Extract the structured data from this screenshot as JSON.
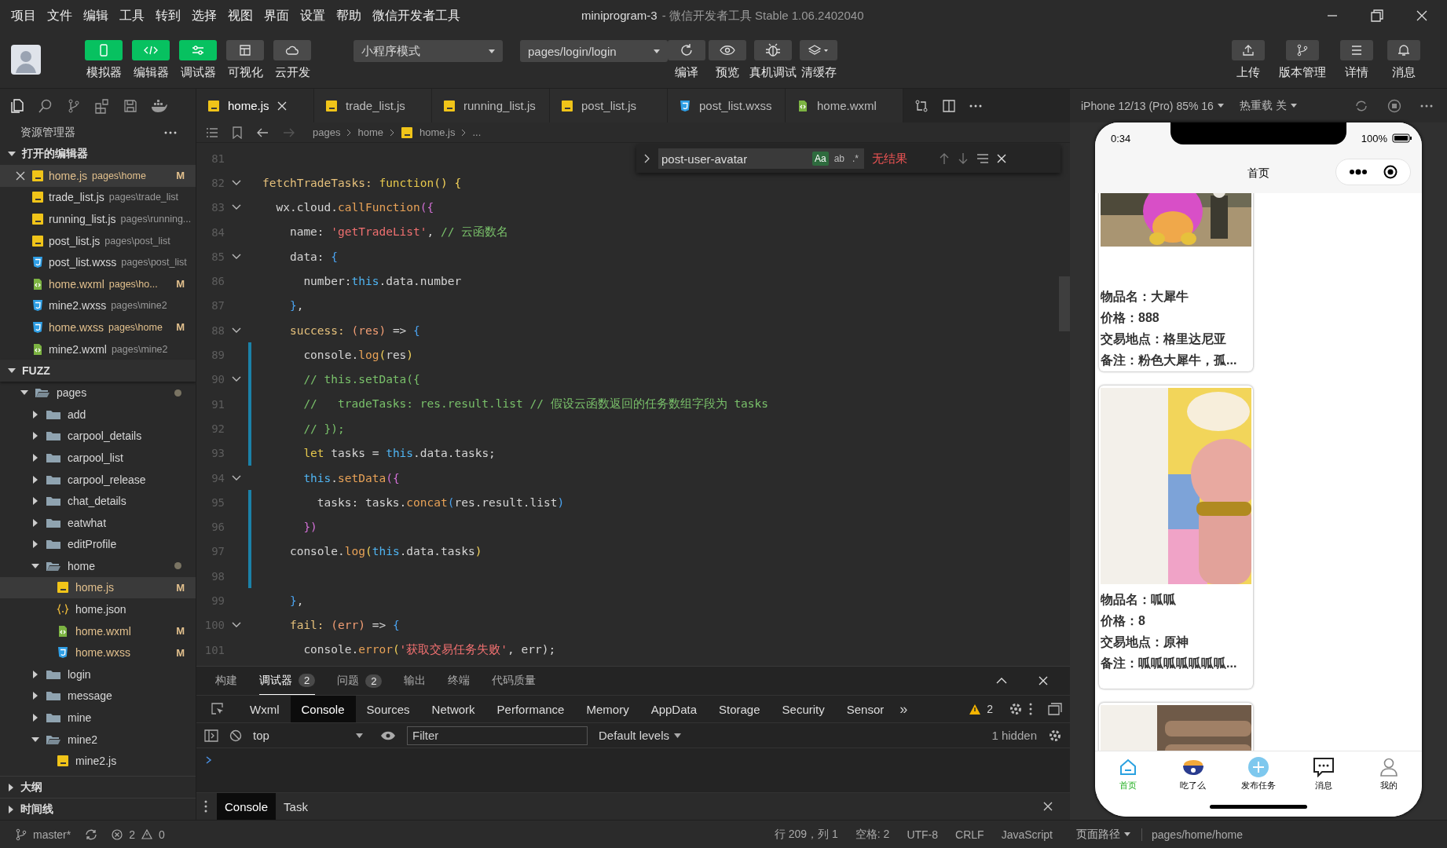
{
  "menu": [
    "项目",
    "文件",
    "编辑",
    "工具",
    "转到",
    "选择",
    "视图",
    "界面",
    "设置",
    "帮助",
    "微信开发者工具"
  ],
  "window": {
    "title": "miniprogram-3",
    "subtitle": "- 微信开发者工具 Stable 1.06.2402040"
  },
  "toolbar": {
    "toggles": [
      {
        "label": "模拟器",
        "kind": "phone",
        "selected": true
      },
      {
        "label": "编辑器",
        "kind": "code",
        "selected": true
      },
      {
        "label": "调试器",
        "kind": "debug",
        "selected": true
      },
      {
        "label": "可视化",
        "kind": "layout",
        "selected": false
      },
      {
        "label": "云开发",
        "kind": "cloud",
        "selected": false
      }
    ],
    "mode": "小程序模式",
    "page": "pages/login/login",
    "actions": [
      {
        "label": "编译",
        "kind": "refresh"
      },
      {
        "label": "预览",
        "kind": "eye"
      },
      {
        "label": "真机调试",
        "kind": "bug"
      },
      {
        "label": "清缓存",
        "kind": "layers"
      }
    ],
    "right": [
      {
        "label": "上传",
        "kind": "upload"
      },
      {
        "label": "版本管理",
        "kind": "branch"
      },
      {
        "label": "详情",
        "kind": "list"
      },
      {
        "label": "消息",
        "kind": "bell"
      }
    ]
  },
  "explorer": {
    "title": "资源管理器",
    "open_editors": {
      "title": "打开的编辑器",
      "items": [
        {
          "name": "home.js",
          "path": "pages\\home",
          "kind": "js",
          "badge": "M",
          "selected": true
        },
        {
          "name": "trade_list.js",
          "path": "pages\\trade_list",
          "kind": "js",
          "selected": false
        },
        {
          "name": "running_list.js",
          "path": "pages\\running...",
          "kind": "js",
          "selected": false
        },
        {
          "name": "post_list.js",
          "path": "pages\\post_list",
          "kind": "js",
          "selected": false
        },
        {
          "name": "post_list.wxss",
          "path": "pages\\post_list",
          "kind": "css",
          "selected": false
        },
        {
          "name": "home.wxml",
          "path": "pages\\ho...",
          "kind": "wxml",
          "badge": "M",
          "selected": false
        },
        {
          "name": "mine2.wxss",
          "path": "pages\\mine2",
          "kind": "css",
          "selected": false
        },
        {
          "name": "home.wxss",
          "path": "pages\\home",
          "kind": "css",
          "badge": "M",
          "selected": false
        },
        {
          "name": "mine2.wxml",
          "path": "pages\\mine2",
          "kind": "wxml",
          "selected": false
        }
      ]
    },
    "project": {
      "title": "FUZZ",
      "tree": [
        {
          "name": "pages",
          "kind": "folder",
          "expanded": true,
          "dot": true,
          "selected": false,
          "children": [
            {
              "name": "add",
              "kind": "folder",
              "expanded": false,
              "selected": false
            },
            {
              "name": "carpool_details",
              "kind": "folder",
              "expanded": false,
              "selected": false
            },
            {
              "name": "carpool_list",
              "kind": "folder",
              "expanded": false,
              "selected": false
            },
            {
              "name": "carpool_release",
              "kind": "folder",
              "expanded": false,
              "selected": false
            },
            {
              "name": "chat_details",
              "kind": "folder",
              "expanded": false,
              "selected": false
            },
            {
              "name": "eatwhat",
              "kind": "folder",
              "expanded": false,
              "selected": false
            },
            {
              "name": "editProfile",
              "kind": "folder",
              "expanded": false,
              "selected": false
            },
            {
              "name": "home",
              "kind": "folder",
              "expanded": true,
              "dot": true,
              "selected": false,
              "children": [
                {
                  "name": "home.js",
                  "kind": "js",
                  "badge": "M",
                  "selected": true
                },
                {
                  "name": "home.json",
                  "kind": "json",
                  "selected": false
                },
                {
                  "name": "home.wxml",
                  "kind": "wxml",
                  "badge": "M",
                  "selected": false
                },
                {
                  "name": "home.wxss",
                  "kind": "css",
                  "badge": "M",
                  "selected": false
                }
              ]
            },
            {
              "name": "login",
              "kind": "folder",
              "expanded": false,
              "selected": false
            },
            {
              "name": "message",
              "kind": "folder",
              "expanded": false,
              "selected": false
            },
            {
              "name": "mine",
              "kind": "folder",
              "expanded": false,
              "selected": false
            },
            {
              "name": "mine2",
              "kind": "folder",
              "expanded": true,
              "selected": false,
              "children": [
                {
                  "name": "mine2.js",
                  "kind": "js",
                  "selected": false
                }
              ]
            }
          ]
        }
      ]
    },
    "sections": [
      "大纲",
      "时间线"
    ]
  },
  "editor": {
    "tabs": [
      {
        "name": "home.js",
        "kind": "js",
        "selected": true
      },
      {
        "name": "trade_list.js",
        "kind": "js",
        "selected": false
      },
      {
        "name": "running_list.js",
        "kind": "js",
        "selected": false
      },
      {
        "name": "post_list.js",
        "kind": "js",
        "selected": false
      },
      {
        "name": "post_list.wxss",
        "kind": "css",
        "selected": false
      },
      {
        "name": "home.wxml",
        "kind": "wxml",
        "selected": false
      }
    ],
    "breadcrumbs": [
      {
        "label": "pages"
      },
      {
        "label": "home"
      },
      {
        "label": "home.js",
        "kind": "js"
      },
      {
        "label": "..."
      }
    ],
    "find": {
      "query": "post-user-avatar",
      "options": [
        {
          "label": "Aa",
          "selected": true
        },
        {
          "label": "ab",
          "selected": false
        },
        {
          "label": ".*",
          "selected": false
        }
      ],
      "result": "无结果"
    },
    "code": [
      {
        "number": "81",
        "fold": false,
        "changed": false
      },
      {
        "number": "82",
        "fold": true,
        "changed": false,
        "tokens": [
          {
            "kind": "prop",
            "text": "fetchTradeTasks: "
          },
          {
            "kind": "kw",
            "text": "function"
          },
          {
            "kind": "b1",
            "text": "() {"
          }
        ]
      },
      {
        "number": "83",
        "fold": true,
        "changed": false,
        "tokens": [
          {
            "kind": "plain",
            "text": "  wx.cloud."
          },
          {
            "kind": "fn",
            "text": "callFunction"
          },
          {
            "kind": "b2",
            "text": "({"
          }
        ]
      },
      {
        "number": "84",
        "fold": false,
        "changed": false,
        "tokens": [
          {
            "kind": "plain",
            "text": "    name: "
          },
          {
            "kind": "str",
            "text": "'getTradeList'"
          },
          {
            "kind": "plain",
            "text": ", "
          },
          {
            "kind": "cmt",
            "text": "// 云函数名"
          }
        ]
      },
      {
        "number": "85",
        "fold": true,
        "changed": false,
        "tokens": [
          {
            "kind": "plain",
            "text": "    data: "
          },
          {
            "kind": "b3",
            "text": "{"
          }
        ]
      },
      {
        "number": "86",
        "fold": false,
        "changed": false,
        "tokens": [
          {
            "kind": "plain",
            "text": "      number:"
          },
          {
            "kind": "this",
            "text": "this"
          },
          {
            "kind": "plain",
            "text": ".data.number"
          }
        ]
      },
      {
        "number": "87",
        "fold": false,
        "changed": false,
        "tokens": [
          {
            "kind": "b3",
            "text": "    }"
          },
          {
            "kind": "plain",
            "text": ","
          }
        ]
      },
      {
        "number": "88",
        "fold": true,
        "changed": false,
        "tokens": [
          {
            "kind": "prop",
            "text": "    success: "
          },
          {
            "kind": "param",
            "text": "(res)"
          },
          {
            "kind": "plain",
            "text": " => "
          },
          {
            "kind": "b3",
            "text": "{"
          }
        ]
      },
      {
        "number": "89",
        "fold": false,
        "changed": true,
        "tokens": [
          {
            "kind": "plain",
            "text": "      console."
          },
          {
            "kind": "fn",
            "text": "log"
          },
          {
            "kind": "b1",
            "text": "("
          },
          {
            "kind": "plain",
            "text": "res"
          },
          {
            "kind": "b1",
            "text": ")"
          }
        ]
      },
      {
        "number": "90",
        "fold": true,
        "changed": true,
        "tokens": [
          {
            "kind": "cmt",
            "text": "      // this.setData({"
          }
        ]
      },
      {
        "number": "91",
        "fold": false,
        "changed": true,
        "tokens": [
          {
            "kind": "cmt",
            "text": "      //   tradeTasks: res.result.list // 假设云函数返回的任务数组字段为 tasks"
          }
        ]
      },
      {
        "number": "92",
        "fold": false,
        "changed": true,
        "tokens": [
          {
            "kind": "cmt",
            "text": "      // });"
          }
        ]
      },
      {
        "number": "93",
        "fold": false,
        "changed": true,
        "tokens": [
          {
            "kind": "kw",
            "text": "      let"
          },
          {
            "kind": "plain",
            "text": " tasks = "
          },
          {
            "kind": "this",
            "text": "this"
          },
          {
            "kind": "plain",
            "text": ".data.tasks;"
          }
        ]
      },
      {
        "number": "94",
        "fold": true,
        "changed": false,
        "tokens": [
          {
            "kind": "this",
            "text": "      this"
          },
          {
            "kind": "plain",
            "text": "."
          },
          {
            "kind": "fn",
            "text": "setData"
          },
          {
            "kind": "b2",
            "text": "({"
          }
        ]
      },
      {
        "number": "95",
        "fold": false,
        "changed": true,
        "tokens": [
          {
            "kind": "plain",
            "text": "        tasks: tasks."
          },
          {
            "kind": "fn",
            "text": "concat"
          },
          {
            "kind": "b3",
            "text": "("
          },
          {
            "kind": "plain",
            "text": "res.result.list"
          },
          {
            "kind": "b3",
            "text": ")"
          }
        ]
      },
      {
        "number": "96",
        "fold": false,
        "changed": true,
        "tokens": [
          {
            "kind": "b2",
            "text": "      })"
          }
        ]
      },
      {
        "number": "97",
        "fold": false,
        "changed": true,
        "tokens": [
          {
            "kind": "plain",
            "text": "    console."
          },
          {
            "kind": "fn",
            "text": "log"
          },
          {
            "kind": "b1",
            "text": "("
          },
          {
            "kind": "this",
            "text": "this"
          },
          {
            "kind": "plain",
            "text": ".data.tasks"
          },
          {
            "kind": "b1",
            "text": ")"
          }
        ]
      },
      {
        "number": "98",
        "fold": false,
        "changed": true
      },
      {
        "number": "99",
        "fold": false,
        "changed": false,
        "tokens": [
          {
            "kind": "b3",
            "text": "    }"
          },
          {
            "kind": "plain",
            "text": ","
          }
        ]
      },
      {
        "number": "100",
        "fold": true,
        "changed": false,
        "tokens": [
          {
            "kind": "prop",
            "text": "    fail: "
          },
          {
            "kind": "param",
            "text": "(err)"
          },
          {
            "kind": "plain",
            "text": " => "
          },
          {
            "kind": "b3",
            "text": "{"
          }
        ]
      },
      {
        "number": "101",
        "fold": false,
        "changed": false,
        "tokens": [
          {
            "kind": "plain",
            "text": "      console."
          },
          {
            "kind": "fn",
            "text": "error"
          },
          {
            "kind": "b1",
            "text": "("
          },
          {
            "kind": "str",
            "text": "'获取交易任务失败'"
          },
          {
            "kind": "plain",
            "text": ", err);"
          }
        ]
      }
    ]
  },
  "panel": {
    "tabs": [
      {
        "label": "构建",
        "selected": false
      },
      {
        "label": "调试器",
        "badge": "2",
        "selected": true
      },
      {
        "label": "问题",
        "badge": "2",
        "selected": false
      },
      {
        "label": "输出",
        "selected": false
      },
      {
        "label": "终端",
        "selected": false
      },
      {
        "label": "代码质量",
        "selected": false
      }
    ],
    "devtools_tabs": [
      {
        "label": "Wxml",
        "selected": false
      },
      {
        "label": "Console",
        "selected": true
      },
      {
        "label": "Sources",
        "selected": false
      },
      {
        "label": "Network",
        "selected": false
      },
      {
        "label": "Performance",
        "selected": false
      },
      {
        "label": "Memory",
        "selected": false
      },
      {
        "label": "AppData",
        "selected": false
      },
      {
        "label": "Storage",
        "selected": false
      },
      {
        "label": "Security",
        "selected": false
      },
      {
        "label": "Sensor",
        "selected": false
      }
    ],
    "more": "»",
    "warnings": "2",
    "context": "top",
    "filter_placeholder": "Filter",
    "levels": "Default levels",
    "hidden": "1 hidden",
    "drawer_tabs": [
      {
        "label": "Console",
        "selected": true
      },
      {
        "label": "Task",
        "selected": false
      }
    ]
  },
  "simulator": {
    "device": "iPhone 12/13 (Pro) 85% 16",
    "hot_reload": "热重载 关",
    "phone": {
      "time": "0:34",
      "battery": "100%",
      "nav_title": "首页",
      "cards": [
        {
          "image": {
            "kind": "picture"
          },
          "lines": [
            "物品名：大犀牛",
            "价格：888",
            "交易地点：格里达尼亚",
            "备注：粉色大犀牛，孤..."
          ]
        },
        {
          "image": {
            "kind": "picture"
          },
          "lines": [
            "物品名：呱呱",
            "价格：8",
            "交易地点：原神",
            "备注：呱呱呱呱呱呱呱..."
          ]
        },
        {
          "image": {
            "kind": "picture"
          }
        }
      ],
      "tabbar": [
        {
          "label": "首页",
          "kind": "home",
          "selected": true
        },
        {
          "label": "吃了么",
          "kind": "bowl",
          "selected": false
        },
        {
          "label": "发布任务",
          "kind": "plus",
          "selected": false
        },
        {
          "label": "消息",
          "kind": "chat",
          "selected": false
        },
        {
          "label": "我的",
          "kind": "user",
          "selected": false
        }
      ]
    }
  },
  "status_bar": {
    "branch": "master*",
    "errors": "2",
    "warnings": "0",
    "items": [
      "行 209，列 1",
      "空格: 2",
      "UTF-8",
      "CRLF",
      "JavaScript"
    ],
    "page_path_label": "页面路径",
    "page_path": "pages/home/home"
  }
}
